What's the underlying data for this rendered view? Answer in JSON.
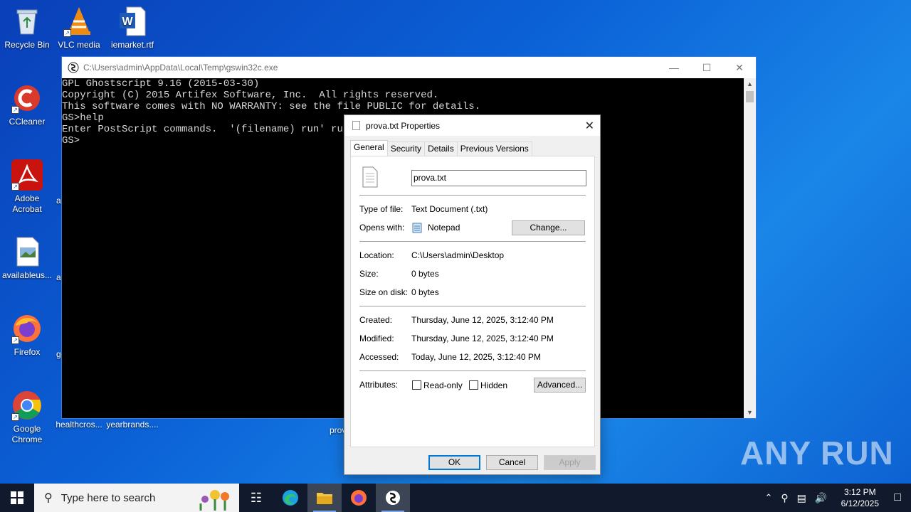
{
  "desktop": {
    "icons": [
      {
        "label": "Recycle Bin"
      },
      {
        "label": "VLC media"
      },
      {
        "label": "iemarket.rtf"
      },
      {
        "label": "CCleaner"
      },
      {
        "label": "Adobe Acrobat"
      },
      {
        "label": "availableus..."
      },
      {
        "label": "Firefox"
      },
      {
        "label": "Google Chrome"
      },
      {
        "label": "healthcros..."
      },
      {
        "label": "yearbrands...."
      },
      {
        "label": "prov"
      }
    ],
    "partial_labels": [
      "a",
      "a",
      "g"
    ]
  },
  "console": {
    "title": "C:\\Users\\admin\\AppData\\Local\\Temp\\gswin32c.exe",
    "lines": [
      "GPL Ghostscript 9.16 (2015-03-30)",
      "Copyright (C) 2015 Artifex Software, Inc.  All rights reserved.",
      "This software comes with NO WARRANTY: see the file PUBLIC for details.",
      "GS>help",
      "Enter PostScript commands.  '(filename) run' runs",
      "GS>"
    ]
  },
  "dialog": {
    "title": "prova.txt Properties",
    "tabs": [
      "General",
      "Security",
      "Details",
      "Previous Versions"
    ],
    "filename": "prova.txt",
    "type_label": "Type of file:",
    "type_value": "Text Document (.txt)",
    "opens_label": "Opens with:",
    "opens_value": "Notepad",
    "change_button": "Change...",
    "location_label": "Location:",
    "location_value": "C:\\Users\\admin\\Desktop",
    "size_label": "Size:",
    "size_value": "0 bytes",
    "sizedisk_label": "Size on disk:",
    "sizedisk_value": "0 bytes",
    "created_label": "Created:",
    "created_value": "Thursday, June 12, 2025, 3:12:40 PM",
    "modified_label": "Modified:",
    "modified_value": "Thursday, June 12, 2025, 3:12:40 PM",
    "accessed_label": "Accessed:",
    "accessed_value": "Today, June 12, 2025, 3:12:40 PM",
    "attributes_label": "Attributes:",
    "readonly_label": "Read-only",
    "hidden_label": "Hidden",
    "advanced_button": "Advanced...",
    "ok_button": "OK",
    "cancel_button": "Cancel",
    "apply_button": "Apply"
  },
  "taskbar": {
    "search_placeholder": "Type here to search",
    "time": "3:12 PM",
    "date": "6/12/2025"
  },
  "watermark": "ANY RUN"
}
